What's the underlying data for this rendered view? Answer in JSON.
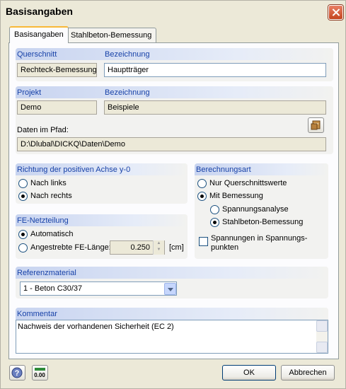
{
  "window": {
    "title": "Basisangaben"
  },
  "tabs": [
    {
      "label": "Basisangaben",
      "active": true
    },
    {
      "label": "Stahlbeton-Bemessung",
      "active": false
    }
  ],
  "querschnitt": {
    "label": "Querschnitt",
    "value": "Rechteck-Bemessung",
    "bezeichnung_label": "Bezeichnung",
    "bezeichnung_value": "Hauptträger"
  },
  "projekt": {
    "label": "Projekt",
    "value": "Demo",
    "bezeichnung_label": "Bezeichnung",
    "bezeichnung_value": "Beispiele",
    "path_label": "Daten im Pfad:",
    "path_value": "D:\\Dlubal\\DICKQ\\Daten\\Demo"
  },
  "richtung": {
    "title": "Richtung der positiven Achse y-0",
    "options": [
      {
        "label": "Nach links",
        "selected": false
      },
      {
        "label": "Nach rechts",
        "selected": true
      }
    ]
  },
  "berechnungsart": {
    "title": "Berechnungsart",
    "option_nur": "Nur Querschnittswerte",
    "option_mit": "Mit Bemessung",
    "sub_spannung": "Spannungsanalyse",
    "sub_stahlbeton": "Stahlbeton-Bemessung",
    "checkbox_line1": "Spannungen in Spannungs-",
    "checkbox_line2": "punkten"
  },
  "fe": {
    "title": "FE-Netzteilung",
    "option_auto": "Automatisch",
    "option_length": "Angestrebte FE-Länge:",
    "length_value": "0.250",
    "unit": "[cm]"
  },
  "referenz": {
    "title": "Referenzmaterial",
    "selected": "1 - Beton C30/37"
  },
  "kommentar": {
    "title": "Kommentar",
    "text": "Nachweis der vorhandenen Sicherheit (EC 2)"
  },
  "buttons": {
    "ok": "OK",
    "cancel": "Abbrechen"
  },
  "icons": {
    "help": "help-icon",
    "units": "units-icon",
    "browse": "folder-browse-icon",
    "close": "close-icon"
  }
}
